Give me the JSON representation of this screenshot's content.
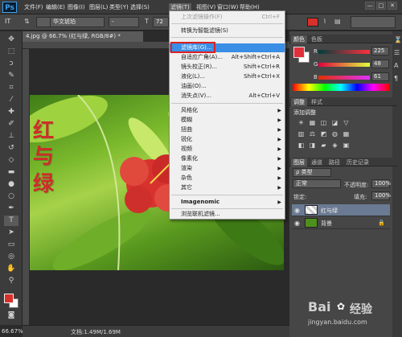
{
  "app": {
    "logo": "Ps"
  },
  "menubar": {
    "items": [
      "文件(F)",
      "编辑(E)",
      "图像(I)",
      "图层(L)",
      "类型(Y)",
      "选择(S)",
      "滤镜(T)",
      "视图(V)",
      "窗口(W)",
      "帮助(H)"
    ],
    "active_item": "滤镜(T)"
  },
  "window_controls": {
    "minimize": "—",
    "maximize": "□",
    "close": "✕"
  },
  "options_bar": {
    "tool_glyph": "IT",
    "font_family": "华文琥珀",
    "font_style": "-",
    "size_prefix": "72"
  },
  "document": {
    "tab_title": "4.jpg @ 66.7% (红与绿, RGB/8#) *",
    "canvas_text": [
      "红",
      "与",
      "绿"
    ],
    "zoom": "66.67%",
    "doc_info": "文档:1.49M/1.69M"
  },
  "filter_menu": {
    "items": [
      {
        "label": "上次滤镜操作(F)",
        "shortcut": "Ctrl+F",
        "disabled": true
      },
      {
        "label": "转换为智能滤镜(S)",
        "shortcut": ""
      },
      {
        "label": "滤镜库(G)...",
        "shortcut": "",
        "highlighted": true
      },
      {
        "label": "自适应广角(A)...",
        "shortcut": "Alt+Shift+Ctrl+A"
      },
      {
        "label": "镜头校正(R)...",
        "shortcut": "Shift+Ctrl+R"
      },
      {
        "label": "液化(L)...",
        "shortcut": "Shift+Ctrl+X"
      },
      {
        "label": "油画(O)...",
        "shortcut": ""
      },
      {
        "label": "消失点(V)...",
        "shortcut": "Alt+Ctrl+V"
      },
      {
        "label": "风格化",
        "submenu": true
      },
      {
        "label": "模糊",
        "submenu": true
      },
      {
        "label": "扭曲",
        "submenu": true
      },
      {
        "label": "锐化",
        "submenu": true
      },
      {
        "label": "视频",
        "submenu": true
      },
      {
        "label": "像素化",
        "submenu": true
      },
      {
        "label": "渲染",
        "submenu": true
      },
      {
        "label": "杂色",
        "submenu": true
      },
      {
        "label": "其它",
        "submenu": true
      },
      {
        "label": "Imagenomic",
        "submenu": true,
        "bold": true
      },
      {
        "label": "浏览联机滤镜...",
        "shortcut": ""
      }
    ]
  },
  "color_panel": {
    "tabs": [
      "颜色",
      "色板"
    ],
    "channels": [
      {
        "label": "R",
        "value": "225"
      },
      {
        "label": "G",
        "value": "48"
      },
      {
        "label": "B",
        "value": "61"
      }
    ],
    "foreground": "#e1303d",
    "background": "#ffffff"
  },
  "adjustments_panel": {
    "tabs": [
      "调整",
      "样式"
    ],
    "subtitle": "添加调整",
    "icons_row1": [
      "☀",
      "▦",
      "◫",
      "◪",
      "▽"
    ],
    "icons_row2": [
      "▥",
      "⚖",
      "◩",
      "◍",
      "▦"
    ],
    "icons_row3": [
      "◧",
      "◨",
      "▰",
      "◈",
      "▣"
    ]
  },
  "layers_panel": {
    "tabs": [
      "图层",
      "通道",
      "路径",
      "历史记录"
    ],
    "filter_kind": "ρ 类型",
    "blend_mode": "正常",
    "opacity_label": "不透明度:",
    "opacity_value": "100%",
    "lock_label": "锁定:",
    "fill_label": "填充:",
    "fill_value": "100%",
    "layers": [
      {
        "name": "红与绿",
        "selected": true
      },
      {
        "name": "背景",
        "selected": false
      }
    ]
  },
  "watermark": {
    "brand": "Bai",
    "brand2": "经验",
    "url": "jingyan.baidu.com"
  }
}
